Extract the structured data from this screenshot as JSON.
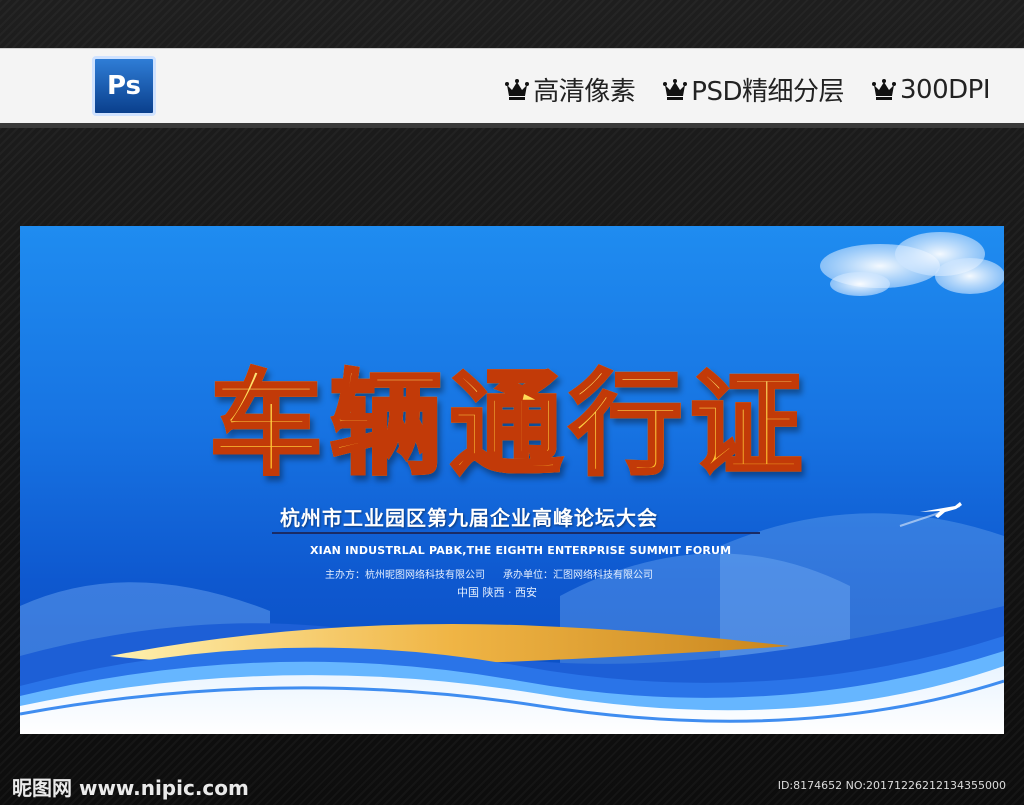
{
  "header": {
    "app_icon_text": "Ps",
    "features": [
      {
        "icon": "crown-icon",
        "label": "高清像素"
      },
      {
        "icon": "crown-icon",
        "label": "PSD精细分层"
      },
      {
        "icon": "crown-icon",
        "label": "300DPI"
      }
    ]
  },
  "poster": {
    "title": "车辆通行证",
    "subtitle": "杭州市工业园区第九届企业高峰论坛大会",
    "english_subtitle": "XIAN INDUSTRLAL PABK,THE EIGHTH ENTERPRISE SUMMIT FORUM",
    "host": "主办方：杭州昵图网络科技有限公司",
    "organizer": "承办单位：汇图网络科技有限公司",
    "location": "中国  陕西 · 西安"
  },
  "watermark": {
    "site": "昵图网 www.nipic.com",
    "id_text": "ID:8174652 NO:20171226212134355000"
  },
  "colors": {
    "sky_top": "#1f8cf0",
    "sky_bottom": "#0a4cc0",
    "title_fill": "#ffd84a",
    "title_stroke": "#c23a08",
    "gold_stripe": "#e8a93a"
  }
}
